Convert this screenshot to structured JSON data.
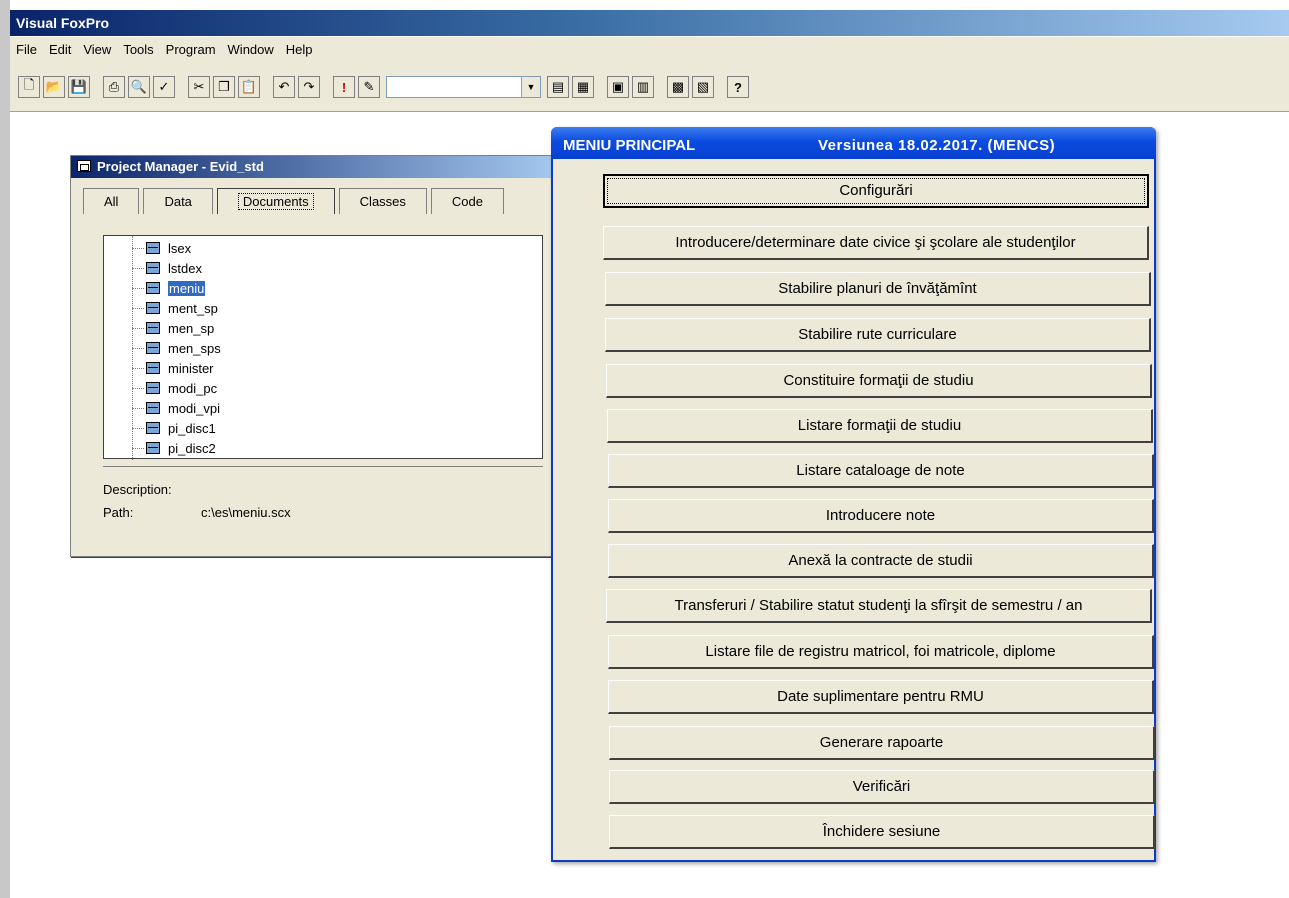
{
  "app": {
    "title": "Visual FoxPro"
  },
  "menubar": [
    "File",
    "Edit",
    "View",
    "Tools",
    "Program",
    "Window",
    "Help"
  ],
  "project_manager": {
    "title": "Project Manager - Evid_std",
    "tabs": [
      "All",
      "Data",
      "Documents",
      "Classes",
      "Code"
    ],
    "active_tab": "Documents",
    "items": [
      "lsex",
      "lstdex",
      "meniu",
      "ment_sp",
      "men_sp",
      "men_sps",
      "minister",
      "modi_pc",
      "modi_vpi",
      "pi_disc1",
      "pi_disc2"
    ],
    "selected_item": "meniu",
    "description_label": "Description:",
    "path_label": "Path:",
    "path_value": "c:\\es\\meniu.scx"
  },
  "main_menu": {
    "title_left": "MENIU PRINCIPAL",
    "title_right": "Versiunea  18.02.2017. (MENCS)",
    "buttons": [
      "Configurări",
      "Introducere/determinare date civice şi şcolare ale studenţilor",
      "Stabilire planuri de învăţămînt",
      "Stabilire rute curriculare",
      "Constituire formaţii de studiu",
      "Listare formaţii de studiu",
      "Listare cataloage de note",
      "Introducere note",
      "Anexă la contracte de studii",
      "Transferuri / Stabilire statut studenţi la sfîrşit de semestru / an",
      "Listare file de registru matricol, foi matricole, diplome",
      "Date suplimentare pentru RMU",
      "Generare rapoarte",
      "Verificări",
      "Închidere sesiune"
    ]
  }
}
